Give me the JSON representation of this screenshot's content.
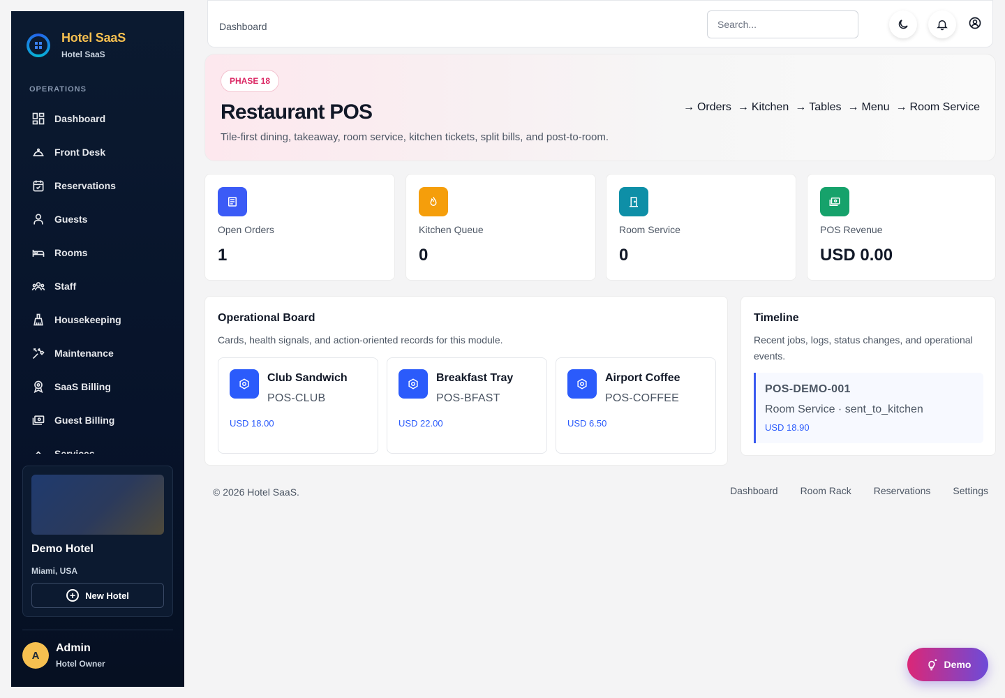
{
  "brand": {
    "title": "Hotel SaaS",
    "subtitle": "Hotel SaaS"
  },
  "sidebar": {
    "section_label": "OPERATIONS",
    "items": [
      {
        "label": "Dashboard",
        "icon": "dashboard-icon"
      },
      {
        "label": "Front Desk",
        "icon": "front-desk-icon"
      },
      {
        "label": "Reservations",
        "icon": "calendar-check-icon"
      },
      {
        "label": "Guests",
        "icon": "user-icon"
      },
      {
        "label": "Rooms",
        "icon": "bed-icon"
      },
      {
        "label": "Staff",
        "icon": "users-icon"
      },
      {
        "label": "Housekeeping",
        "icon": "broom-icon"
      },
      {
        "label": "Maintenance",
        "icon": "tools-icon"
      },
      {
        "label": "SaaS Billing",
        "icon": "badge-icon"
      },
      {
        "label": "Guest Billing",
        "icon": "cash-icon"
      },
      {
        "label": "Services",
        "icon": "chevron-up-icon"
      }
    ],
    "hotel": {
      "name": "Demo Hotel",
      "location": "Miami, USA",
      "new_hotel_label": "New Hotel"
    },
    "user": {
      "initial": "A",
      "name": "Admin",
      "role": "Hotel Owner"
    }
  },
  "topbar": {
    "breadcrumb": "Dashboard",
    "search_placeholder": "Search..."
  },
  "hero": {
    "badge": "PHASE 18",
    "title": "Restaurant POS",
    "description": "Tile-first dining, takeaway, room service, kitchen tickets, split bills, and post-to-room.",
    "links": [
      "Orders",
      "Kitchen",
      "Tables",
      "Menu",
      "Room Service"
    ]
  },
  "stats": [
    {
      "label": "Open Orders",
      "value": "1",
      "color": "#3b5bf6",
      "icon": "document-icon"
    },
    {
      "label": "Kitchen Queue",
      "value": "0",
      "color": "#f59e0b",
      "icon": "flame-icon"
    },
    {
      "label": "Room Service",
      "value": "0",
      "color": "#0e8fa7",
      "icon": "door-icon"
    },
    {
      "label": "POS Revenue",
      "value": "USD 0.00",
      "color": "#16a26b",
      "icon": "cash-icon"
    }
  ],
  "board": {
    "title": "Operational Board",
    "description": "Cards, health signals, and action-oriented records for this module.",
    "items": [
      {
        "name": "Club Sandwich",
        "code": "POS-CLUB",
        "price": "USD 18.00"
      },
      {
        "name": "Breakfast Tray",
        "code": "POS-BFAST",
        "price": "USD 22.00"
      },
      {
        "name": "Airport Coffee",
        "code": "POS-COFFEE",
        "price": "USD 6.50"
      }
    ]
  },
  "timeline": {
    "title": "Timeline",
    "description": "Recent jobs, logs, status changes, and operational events.",
    "entry": {
      "id": "POS-DEMO-001",
      "meta": "Room Service · sent_to_kitchen",
      "amount": "USD 18.90"
    }
  },
  "footer": {
    "copyright": "© 2026 Hotel SaaS.",
    "links": [
      "Dashboard",
      "Room Rack",
      "Reservations",
      "Settings"
    ]
  },
  "demo_button": "Demo",
  "colors": {
    "accent": "#2b5bfb",
    "sidebar_bg": "#0b1a30",
    "brand_gold": "#f6c050",
    "phase_pink": "#db2763"
  }
}
